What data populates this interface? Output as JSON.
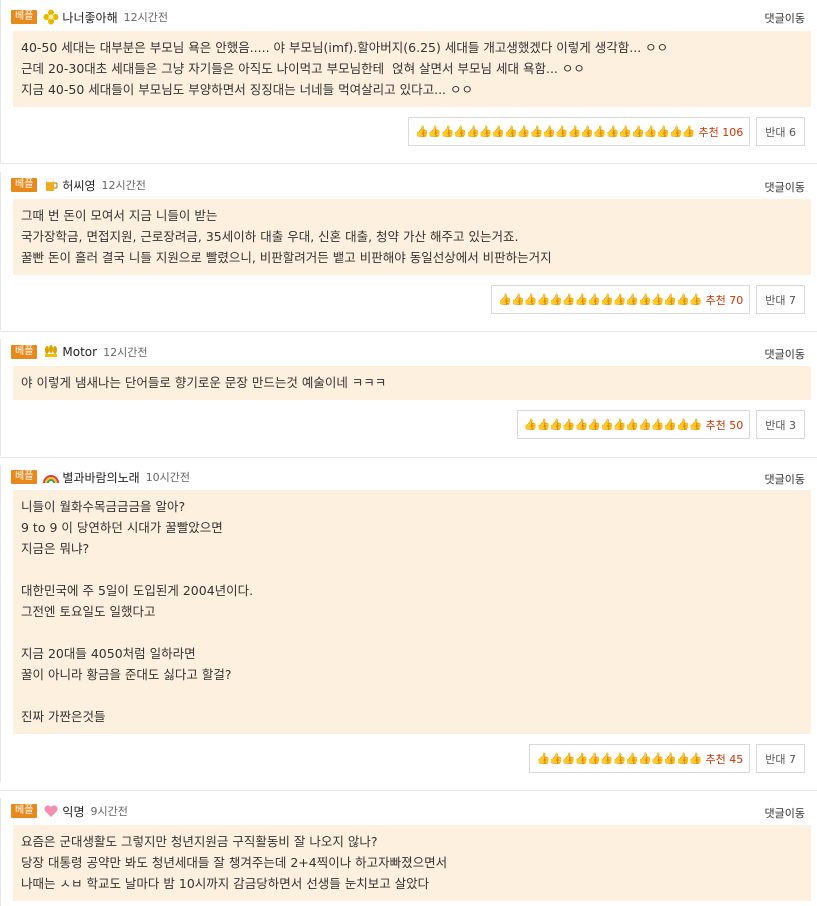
{
  "labels": {
    "best": "베플",
    "reply": "댓글이동"
  },
  "colors": {
    "best_badge": "#e8891c",
    "comment_bg": "#fdf0df",
    "recommend_text": "#cc3300"
  },
  "comments": [
    {
      "icon": "gold-flower-icon",
      "nickname": "나너좋아해",
      "time": "12시간전",
      "text": "40-50 세대는 대부분은 부모님 욕은 안했음..... 야 부모님(imf).할아버지(6.25) 세대들 개고생했겠다 이렇게 생각함... ㅇㅇ\n근데 20-30대초 세대들은 그냥 자기들은 아직도 나이먹고 부모님한테  얹혀 살면서 부모님 세대 욕함... ㅇㅇ\n지금 40-50 세대들이 부모님도 부양하면서 징징대는 너네들 먹여살리고 있다고... ㅇㅇ",
      "thumbs": "👍👍👍👍👍👍👍👍👍👍👍👍👍👍👍👍👍👍👍👍👍👍",
      "recommend": "추천 106",
      "oppose": "반대 6"
    },
    {
      "icon": "beer-icon",
      "nickname": "허씨영",
      "time": "12시간전",
      "text": "그때 번 돈이 모여서 지금 니들이 받는\n국가장학금, 면접지원, 근로장려금, 35세이하 대출 우대, 신혼 대출, 청약 가산 해주고 있는거죠.\n꿀빤 돈이 흘러 결국 니들 지원으로 빨렸으니, 비판할려거든 뱉고 비판해야 동일선상에서 비판하는거지",
      "thumbs": "👍👍👍👍👍👍👍👍👍👍👍👍👍👍👍👍",
      "recommend": "추천 70",
      "oppose": "반대 7"
    },
    {
      "icon": "gold-wheat-icon",
      "nickname": "Motor",
      "time": "12시간전",
      "text": "야 이렇게 냄새나는 단어들로 향기로운 문장 만드는것 예술이네 ㅋㅋㅋ",
      "thumbs": "👍👍👍👍👍👍👍👍👍👍👍👍👍👍",
      "recommend": "추천 50",
      "oppose": "반대 3"
    },
    {
      "icon": "rainbow-icon",
      "nickname": "별과바람의노래",
      "time": "10시간전",
      "text": "니들이 월화수목금금금을 알아?\n9 to 9 이 당연하던 시대가 꿀빨았으면\n지금은 뭐냐?\n\n대한민국에 주 5일이 도입된게 2004년이다.\n그전엔 토요일도 일했다고\n\n지금 20대들 4050처럼 일하라면\n꿀이 아니라 황금을 준대도 싫다고 할걸?\n\n진짜 가짠은것들",
      "thumbs": "👍👍👍👍👍👍👍👍👍👍👍👍👍",
      "recommend": "추천 45",
      "oppose": "반대 7"
    },
    {
      "icon": "heart-icon",
      "nickname": "익명",
      "time": "9시간전",
      "text": "요즘은 군대생활도 그렇지만 청년지원금 구직활동비 잘 나오지 않나?\n당장 대통령 공약만 봐도 청년세대들 잘 챙겨주는데 2+4찍이나 하고자빠졌으면서\n나때는 ㅅㅂ 학교도 날마다 밤 10시까지 감금당하면서 선생들 눈치보고 살았다",
      "thumbs": "",
      "recommend": "",
      "oppose": ""
    }
  ]
}
